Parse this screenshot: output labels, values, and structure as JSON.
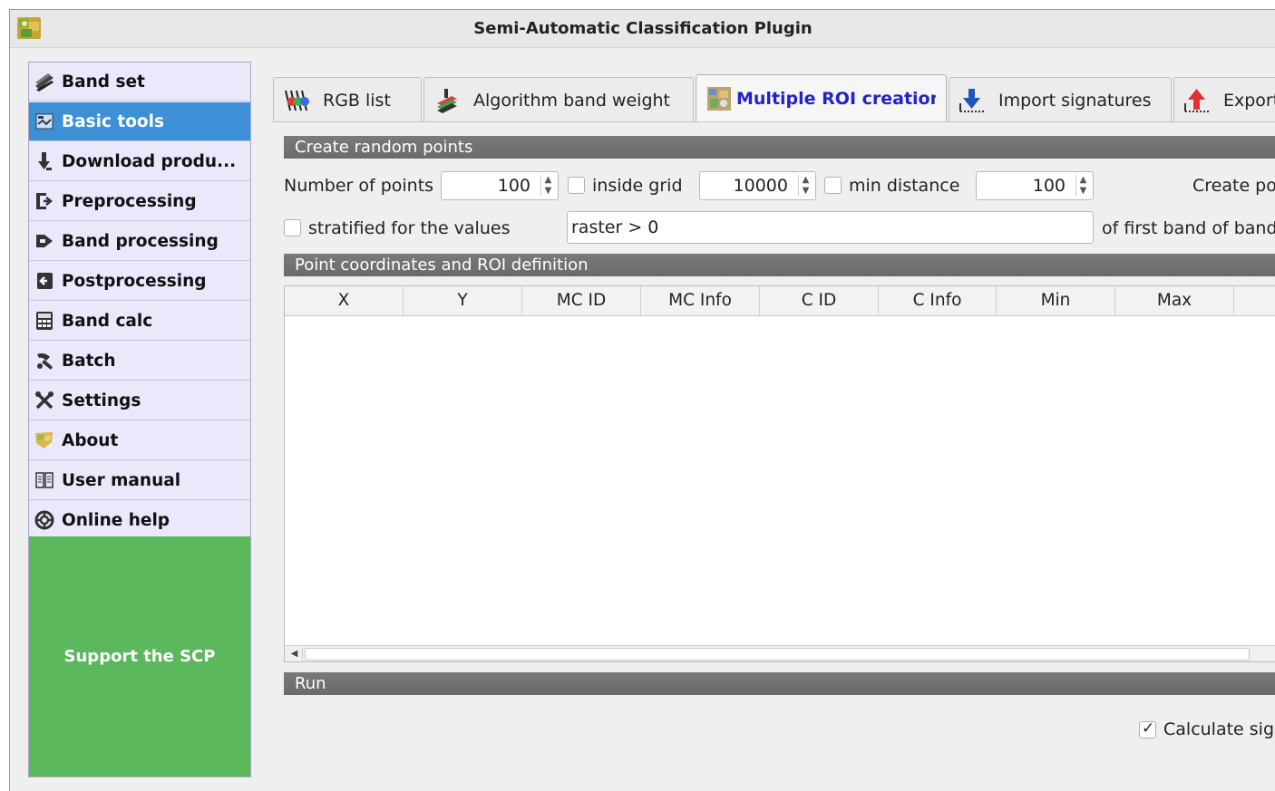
{
  "window": {
    "title": "Semi-Automatic Classification Plugin"
  },
  "sidebar": {
    "items": [
      {
        "label": "Band set",
        "icon": "bandset-icon"
      },
      {
        "label": "Basic tools",
        "icon": "basic-tools-icon",
        "active": true
      },
      {
        "label": "Download produ...",
        "icon": "download-icon"
      },
      {
        "label": "Preprocessing",
        "icon": "preprocessing-icon"
      },
      {
        "label": "Band processing",
        "icon": "band-processing-icon"
      },
      {
        "label": "Postprocessing",
        "icon": "postprocessing-icon"
      },
      {
        "label": "Band calc",
        "icon": "calculator-icon"
      },
      {
        "label": "Batch",
        "icon": "batch-icon"
      },
      {
        "label": "Settings",
        "icon": "settings-icon"
      },
      {
        "label": "About",
        "icon": "about-icon"
      },
      {
        "label": "User manual",
        "icon": "manual-icon"
      },
      {
        "label": "Online help",
        "icon": "help-icon"
      }
    ],
    "support_label": "Support the SCP",
    "active_color": "#3d8fd6",
    "support_color": "#5bb85d"
  },
  "tabs": [
    {
      "label": "RGB list",
      "icon": "rgb-icon"
    },
    {
      "label": "Algorithm band weight",
      "icon": "band-weight-icon"
    },
    {
      "label": "Multiple ROI creation",
      "icon": "multiple-roi-icon",
      "active": true
    },
    {
      "label": "Import signatures",
      "icon": "import-icon"
    },
    {
      "label": "Export",
      "icon": "export-icon"
    }
  ],
  "random_points": {
    "section_title": "Create random points",
    "number_of_points_label": "Number of points",
    "number_of_points_value": "100",
    "inside_grid_label": "inside grid",
    "inside_grid_checked": false,
    "grid_value": "10000",
    "min_distance_label": "min distance",
    "min_distance_checked": false,
    "min_distance_value": "100",
    "create_points_label": "Create po",
    "stratified_label": "stratified for the values",
    "stratified_checked": false,
    "expression_value": "raster > 0",
    "first_band_label": "of first band of band"
  },
  "roi_table": {
    "section_title": "Point coordinates and ROI definition",
    "columns": [
      "X",
      "Y",
      "MC ID",
      "MC Info",
      "C ID",
      "C Info",
      "Min",
      "Max"
    ],
    "rows": []
  },
  "run": {
    "section_title": "Run",
    "calculate_label": "Calculate sig",
    "calculate_checked": true
  }
}
